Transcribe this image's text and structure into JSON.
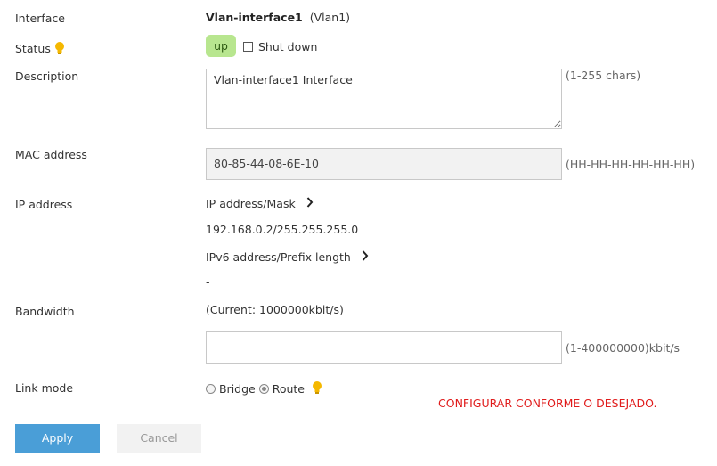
{
  "interface": {
    "label": "Interface",
    "name": "Vlan-interface1",
    "alias": "(Vlan1)"
  },
  "status": {
    "label": "Status",
    "value": "up",
    "shutdown_label": "Shut down",
    "icon": "lightbulb-icon"
  },
  "description": {
    "label": "Description",
    "value": "Vlan-interface1 Interface",
    "hint": "(1-255 chars)"
  },
  "mac": {
    "label": "MAC address",
    "value": "80-85-44-08-6E-10",
    "hint": "(HH-HH-HH-HH-HH-HH)"
  },
  "ip": {
    "label": "IP address",
    "ipv4_link": "IP address/Mask",
    "ipv4_value": "192.168.0.2/255.255.255.0",
    "ipv6_link": "IPv6 address/Prefix length",
    "ipv6_value": "-"
  },
  "bandwidth": {
    "label": "Bandwidth",
    "current": "(Current: 1000000kbit/s)",
    "value": "",
    "hint": "(1-400000000)kbit/s"
  },
  "link_mode": {
    "label": "Link mode",
    "option_bridge": "Bridge",
    "option_route": "Route",
    "selected": "Route"
  },
  "note": "CONFIGURAR CONFORME O DESEJADO.",
  "buttons": {
    "apply": "Apply",
    "cancel": "Cancel"
  },
  "colors": {
    "accent": "#4a9ed7",
    "status_up": "#b8e68f",
    "note": "#e01b1b",
    "bulb": "#f5b800"
  }
}
